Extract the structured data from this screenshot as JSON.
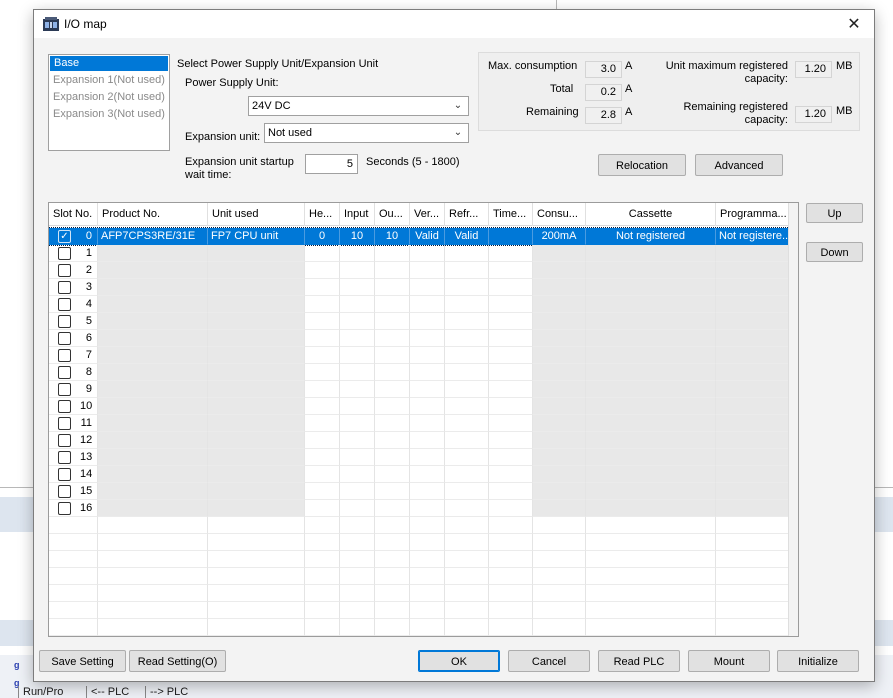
{
  "dialog": {
    "title": "I/O map",
    "close_symbol": "✕"
  },
  "unit_list": [
    {
      "label": "Base",
      "selected": true
    },
    {
      "label": "Expansion 1(Not used)",
      "selected": false
    },
    {
      "label": "Expansion 2(Not used)",
      "selected": false
    },
    {
      "label": "Expansion 3(Not used)",
      "selected": false
    }
  ],
  "power": {
    "section_label": "Select Power Supply Unit/Expansion Unit",
    "power_label": "Power Supply Unit:",
    "power_value": "24V DC",
    "expansion_label": "Expansion unit:",
    "expansion_value": "Not used",
    "startup_label_1": "Expansion unit startup",
    "startup_label_2": "wait time:",
    "startup_value": "5",
    "startup_unit": "Seconds (5 - 1800)"
  },
  "consumption": {
    "max_label": "Max. consumption",
    "max_value": "3.0",
    "max_unit": "A",
    "total_label": "Total",
    "total_value": "0.2",
    "total_unit": "A",
    "remaining_label": "Remaining",
    "remaining_value": "2.8",
    "remaining_unit": "A",
    "cap_label_1": "Unit maximum registered",
    "cap_label_2": "capacity:",
    "cap_value": "1.20",
    "cap_unit": "MB",
    "remcap_label_1": "Remaining registered",
    "remcap_label_2": "capacity:",
    "remcap_value": "1.20",
    "remcap_unit": "MB"
  },
  "buttons": {
    "relocation": "Relocation",
    "advanced": "Advanced",
    "up": "Up",
    "down": "Down",
    "save_setting": "Save Setting",
    "read_setting": "Read Setting(O)",
    "ok": "OK",
    "cancel": "Cancel",
    "read_plc": "Read PLC",
    "mount": "Mount",
    "initialize": "Initialize"
  },
  "grid": {
    "columns": [
      "Slot No.",
      "Product No.",
      "Unit used",
      "He...",
      "Input",
      "Ou...",
      "Ver...",
      "Refr...",
      "Time...",
      "Consu...",
      "Cassette",
      "Programma..."
    ],
    "row0": {
      "slot": "0",
      "product": "AFP7CPS3RE/31E",
      "unit": "FP7 CPU unit",
      "head": "0",
      "input": "10",
      "output": "10",
      "verify": "Valid",
      "refresh": "Valid",
      "time": "",
      "consumption": "200mA",
      "cassette": "Not registered",
      "programmable": "Not registere..."
    },
    "slots": [
      "1",
      "2",
      "3",
      "4",
      "5",
      "6",
      "7",
      "8",
      "9",
      "10",
      "11",
      "12",
      "13",
      "14",
      "15",
      "16"
    ]
  },
  "background": {
    "tab_run": "Run/Pro",
    "tab_from_plc": "<-- PLC",
    "tab_to_plc": "--> PLC"
  }
}
